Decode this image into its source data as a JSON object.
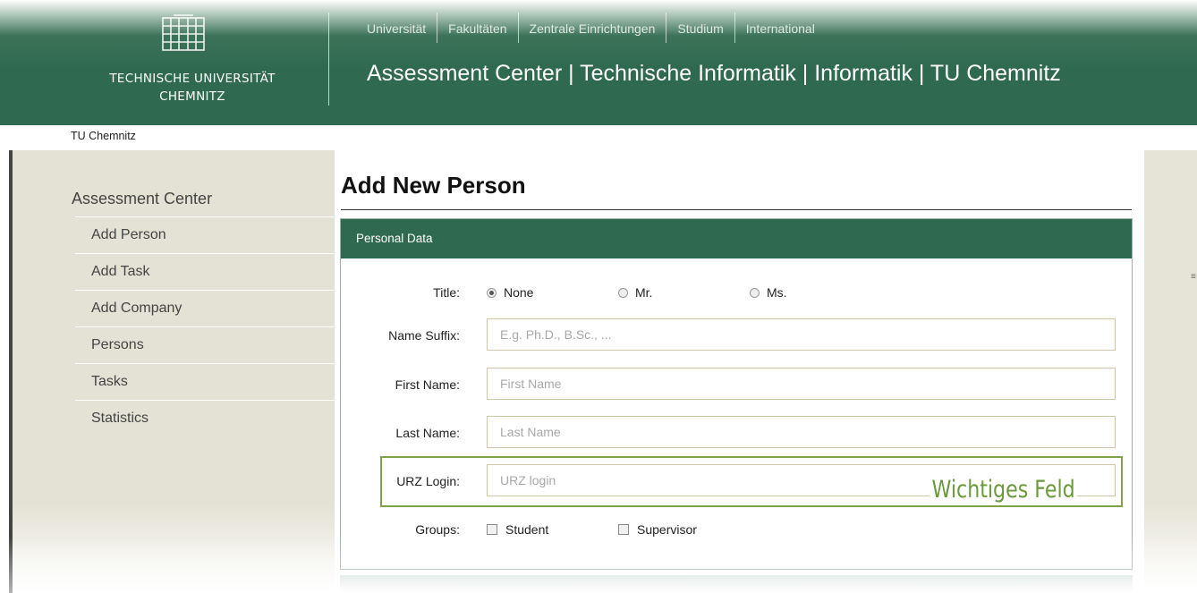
{
  "header": {
    "logo_line1": "TECHNISCHE UNIVERSITÄT",
    "logo_line2": "CHEMNITZ",
    "nav": [
      "Universität",
      "Fakultäten",
      "Zentrale Einrichtungen",
      "Studium",
      "International"
    ],
    "site_title": "Assessment Center | Technische Informatik | Informatik | TU Chemnitz"
  },
  "breadcrumb": "TU Chemnitz",
  "sidebar": {
    "heading": "Assessment Center",
    "items": [
      {
        "label": "Add Person"
      },
      {
        "label": "Add Task"
      },
      {
        "label": "Add Company"
      },
      {
        "label": "Persons"
      },
      {
        "label": "Tasks"
      },
      {
        "label": "Statistics"
      }
    ]
  },
  "main": {
    "page_title": "Add New Person",
    "panel_title": "Personal Data",
    "title_field": {
      "label": "Title:",
      "options": [
        {
          "label": "None",
          "checked": true
        },
        {
          "label": "Mr.",
          "checked": false
        },
        {
          "label": "Ms.",
          "checked": false
        }
      ]
    },
    "name_suffix": {
      "label": "Name Suffix:",
      "placeholder": "E.g. Ph.D., B.Sc., ...",
      "value": ""
    },
    "first_name": {
      "label": "First Name:",
      "placeholder": "First Name",
      "value": ""
    },
    "last_name": {
      "label": "Last Name:",
      "placeholder": "Last Name",
      "value": ""
    },
    "urz_login": {
      "label": "URZ Login:",
      "placeholder": "URZ login",
      "value": ""
    },
    "groups": {
      "label": "Groups:",
      "options": [
        {
          "label": "Student",
          "checked": false
        },
        {
          "label": "Supervisor",
          "checked": false
        }
      ]
    }
  },
  "annotation": {
    "label": "Wichtiges Feld",
    "color": "#7da249"
  },
  "colors": {
    "brand_green": "#2f6a50",
    "sidebar_bg": "#e4e2d4"
  }
}
